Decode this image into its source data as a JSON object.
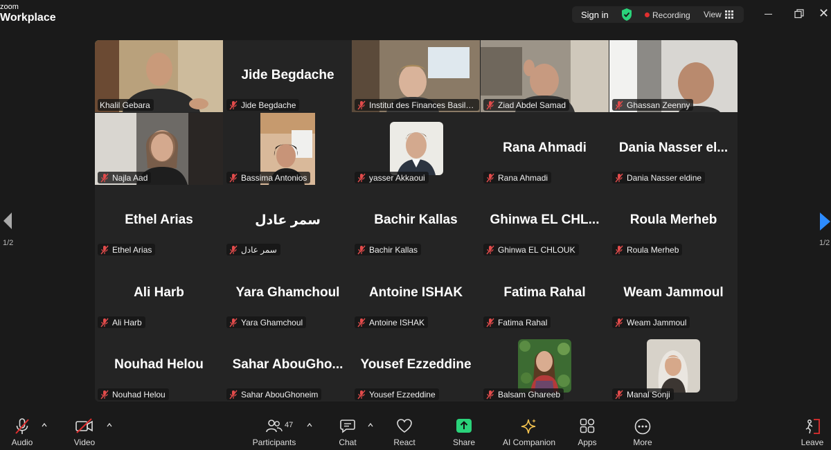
{
  "app": {
    "brand_line1": "zoom",
    "brand_line2": "Workplace"
  },
  "topbar": {
    "signin": "Sign in",
    "recording": "Recording",
    "view": "View"
  },
  "pager": {
    "left": "1/2",
    "right": "1/2"
  },
  "participants": [
    {
      "display": "",
      "label": "Khalil Gebara"
    },
    {
      "display": "Jide Begdache",
      "label": "Jide Begdache"
    },
    {
      "display": "",
      "label": "Institut des Finances Basil Fu..."
    },
    {
      "display": "",
      "label": "Ziad Abdel Samad"
    },
    {
      "display": "",
      "label": "Ghassan Zeenny"
    },
    {
      "display": "",
      "label": "Najla Aad"
    },
    {
      "display": "",
      "label": "Bassima Antonios"
    },
    {
      "display": "",
      "label": "yasser Akkaoui"
    },
    {
      "display": "Rana Ahmadi",
      "label": "Rana Ahmadi"
    },
    {
      "display": "Dania  Nasser  el...",
      "label": "Dania Nasser eldine"
    },
    {
      "display": "Ethel Arias",
      "label": "Ethel Arias"
    },
    {
      "display": "سمر عادل",
      "label": "سمر عادل"
    },
    {
      "display": "Bachir Kallas",
      "label": "Bachir Kallas"
    },
    {
      "display": "Ghinwa  EL  CHL...",
      "label": "Ghinwa EL CHLOUK"
    },
    {
      "display": "Roula Merheb",
      "label": "Roula Merheb"
    },
    {
      "display": "Ali Harb",
      "label": "Ali Harb"
    },
    {
      "display": "Yara Ghamchoul",
      "label": "Yara Ghamchoul"
    },
    {
      "display": "Antoine ISHAK",
      "label": "Antoine ISHAK"
    },
    {
      "display": "Fatima Rahal",
      "label": "Fatima Rahal"
    },
    {
      "display": "Weam Jammoul",
      "label": "Weam Jammoul"
    },
    {
      "display": "Nouhad Helou",
      "label": "Nouhad Helou"
    },
    {
      "display": "Sahar  AbouGho...",
      "label": "Sahar AbouGhoneim"
    },
    {
      "display": "Yousef Ezzeddine",
      "label": "Yousef Ezzeddine"
    },
    {
      "display": "",
      "label": "Balsam Ghareeb"
    },
    {
      "display": "",
      "label": "Manal Sonji"
    }
  ],
  "toolbar": {
    "audio": "Audio",
    "video": "Video",
    "participants": "Participants",
    "participants_count": "47",
    "chat": "Chat",
    "react": "React",
    "share": "Share",
    "ai_companion": "AI Companion",
    "apps": "Apps",
    "more": "More",
    "leave": "Leave"
  },
  "colors": {
    "active_speaker": "#29d17e",
    "share": "#2ad37a",
    "ai": "#f3c24f",
    "recording": "#e02f2f",
    "leave": "#e02f2f"
  }
}
